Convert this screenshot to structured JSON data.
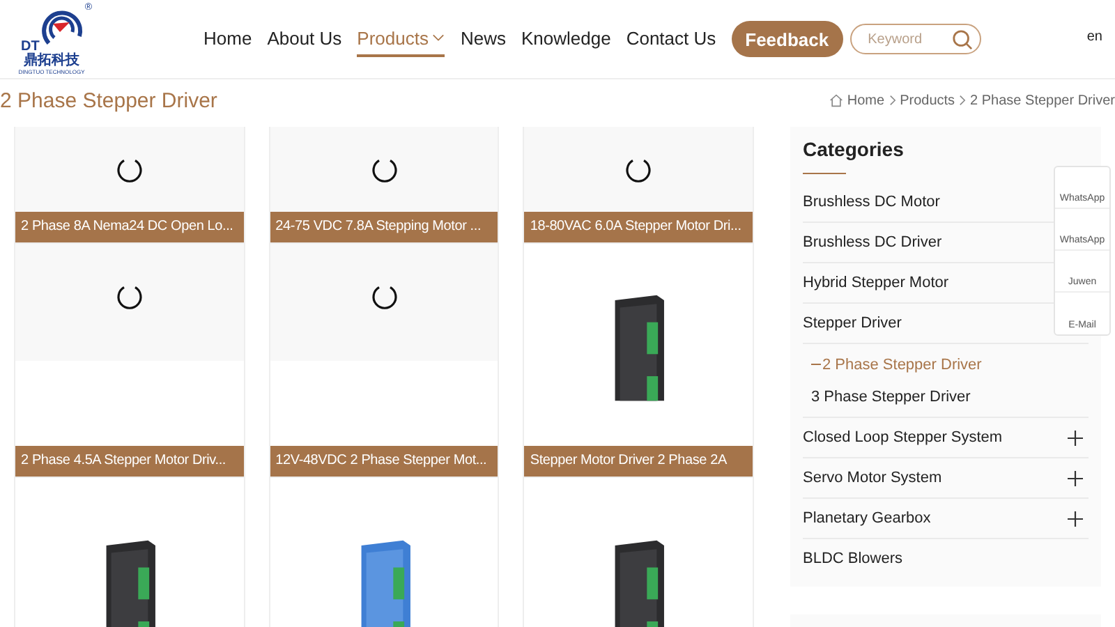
{
  "logo": {
    "mark": "DT",
    "name_cn": "鼎拓科技",
    "name_en": "DINGTUO TECHNOLOGY",
    "registered": "®"
  },
  "nav": [
    {
      "label": "Home",
      "selected": false,
      "dropdown": false
    },
    {
      "label": "About Us",
      "selected": false,
      "dropdown": false
    },
    {
      "label": "Products",
      "selected": true,
      "dropdown": true
    },
    {
      "label": "News",
      "selected": false,
      "dropdown": false
    },
    {
      "label": "Knowledge",
      "selected": false,
      "dropdown": false
    },
    {
      "label": "Contact Us",
      "selected": false,
      "dropdown": false
    }
  ],
  "feedback_button": "Feedback",
  "search": {
    "placeholder": "Keyword"
  },
  "language": "en",
  "page_title": "2 Phase Stepper Driver",
  "breadcrumb": [
    "Home",
    "Products",
    "2 Phase Stepper Driver"
  ],
  "product_rows": [
    {
      "cards": [
        {
          "kind": "loading",
          "title": "2 Phase 8A Nema24 DC Open Lo..."
        },
        {
          "kind": "loading",
          "title": "24-75 VDC 7.8A Stepping Motor ..."
        },
        {
          "kind": "loading",
          "title": "18-80VAC 6.0A Stepper Motor Dri..."
        }
      ]
    },
    {
      "cards": [
        {
          "kind": "loading",
          "title": "2 Phase 4.5A Stepper Motor Driv..."
        },
        {
          "kind": "loading",
          "title": "12V-48VDC 2 Phase Stepper Mot..."
        },
        {
          "kind": "black",
          "title": "Stepper Motor Driver 2 Phase 2A"
        }
      ]
    },
    {
      "cards": [
        {
          "kind": "black"
        },
        {
          "kind": "blue"
        },
        {
          "kind": "black"
        }
      ]
    }
  ],
  "categories": {
    "title": "Categories",
    "items": [
      {
        "label": "Brushless DC Motor"
      },
      {
        "label": "Brushless DC Driver"
      },
      {
        "label": "Hybrid Stepper Motor"
      },
      {
        "label": "Stepper Driver",
        "children": [
          {
            "label": "2 Phase Stepper Driver",
            "selected": true
          },
          {
            "label": "3 Phase Stepper Driver",
            "selected": false
          }
        ]
      },
      {
        "label": "Closed Loop Stepper System",
        "expandable": true
      },
      {
        "label": "Servo Motor System",
        "expandable": true
      },
      {
        "label": "Planetary Gearbox",
        "expandable": true
      },
      {
        "label": "BLDC Blowers"
      }
    ]
  },
  "contact_panel": [
    "WhatsApp",
    "WhatsApp",
    "Juwen",
    "E-Mail"
  ]
}
